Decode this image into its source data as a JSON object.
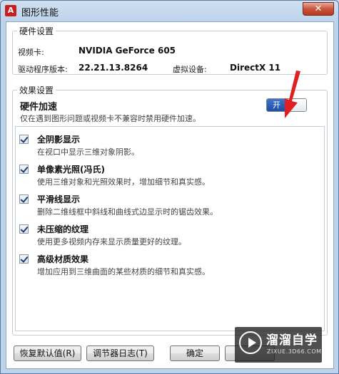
{
  "window": {
    "title": "图形性能",
    "app_icon_letter": "A",
    "close_glyph": "✕"
  },
  "hardware": {
    "group_title": "硬件设置",
    "video_card_label": "视频卡:",
    "video_card_value": "NVIDIA GeForce 605",
    "driver_label": "驱动程序版本:",
    "driver_value": "22.21.13.8264",
    "virtual_device_label": "虚拟设备:",
    "virtual_device_value": "DirectX 11"
  },
  "effects": {
    "group_title": "效果设置",
    "hw_accel_title": "硬件加速",
    "hw_accel_desc": "仅在遇到图形问题或视频卡不兼容时禁用硬件加速。",
    "toggle_state_label": "开",
    "toggle_on": true,
    "items": [
      {
        "title": "全阴影显示",
        "desc": "在视口中显示三维对象阴影。",
        "checked": true
      },
      {
        "title": "单像素光照(冯氏)",
        "desc": "使用三维对象和光照效果时，增加细节和真实感。",
        "checked": true
      },
      {
        "title": "平滑线显示",
        "desc": "删除二维线框中斜线和曲线式边显示时的锯齿效果。",
        "checked": true
      },
      {
        "title": "未压缩的纹理",
        "desc": "使用更多视频内存来显示质量更好的纹理。",
        "checked": true
      },
      {
        "title": "高级材质效果",
        "desc": "增加应用到三维曲面的某些材质的细节和真实感。",
        "checked": true
      }
    ]
  },
  "buttons": {
    "restore_defaults": "恢复默认值(R)",
    "tuner_log": "调节器日志(T)",
    "ok": "确定"
  },
  "watermark": {
    "title": "溜溜自学",
    "url": "ZIXUE.3D66.COM"
  },
  "colors": {
    "toggle_on": "#2458b0",
    "annotation_arrow": "#e02020"
  }
}
